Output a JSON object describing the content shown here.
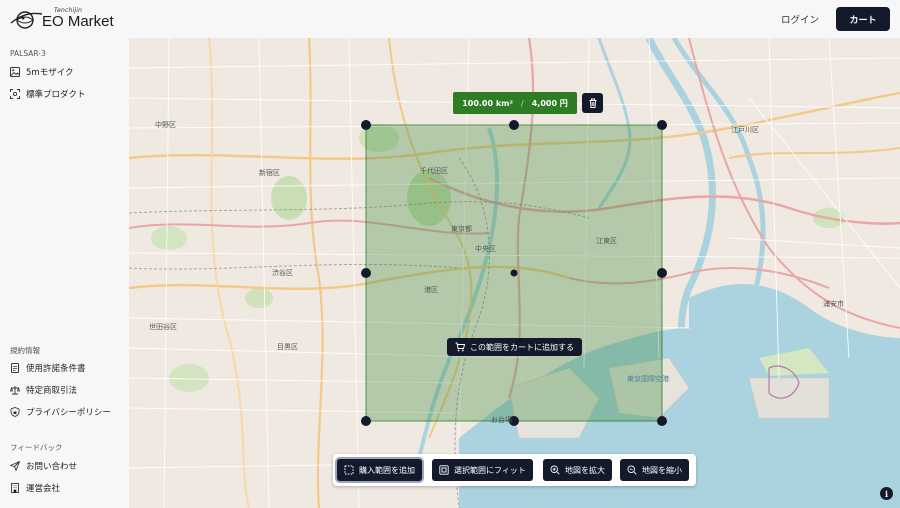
{
  "header": {
    "logo_small": "Tenchijin",
    "logo_main": "EO Market",
    "login_label": "ログイン",
    "cart_label": "カート"
  },
  "sidebar": {
    "section_product": "PALSAR-3",
    "products": [
      {
        "label": "5mモザイク",
        "icon": "image-icon"
      },
      {
        "label": "標準プロダクト",
        "icon": "scan-icon"
      }
    ],
    "section_terms": "規約情報",
    "terms": [
      {
        "label": "使用許諾条件書",
        "icon": "document-icon"
      },
      {
        "label": "特定商取引法",
        "icon": "scale-icon"
      },
      {
        "label": "プライバシーポリシー",
        "icon": "shield-lock-icon"
      }
    ],
    "section_feedback": "フィードバック",
    "feedback": [
      {
        "label": "お問い合わせ",
        "icon": "send-icon"
      },
      {
        "label": "運営会社",
        "icon": "building-icon"
      }
    ]
  },
  "map": {
    "area_value": "100.00 km²",
    "area_separator": "/",
    "price_value": "4,000 円",
    "add_to_cart_label": "この範囲をカートに追加する",
    "selection_color": "#3a8a3a",
    "labels": {
      "nakano": "中野区",
      "shinjuku": "新宿区",
      "shibuya": "渋谷区",
      "setagaya": "世田谷区",
      "meguro": "目黒区",
      "chiyoda": "千代田区",
      "tokyo_to": "東京都",
      "chuo": "中央区",
      "minato": "港区",
      "koto": "江東区",
      "edogawa": "江戸川区",
      "urayasu": "浦安市",
      "odaiba": "お台場",
      "haneda": "東京国際空港"
    }
  },
  "toolbar": {
    "add_area_label": "購入範囲を追加",
    "fit_label": "選択範囲にフィット",
    "zoom_in_label": "地図を拡大",
    "zoom_out_label": "地図を縮小"
  }
}
